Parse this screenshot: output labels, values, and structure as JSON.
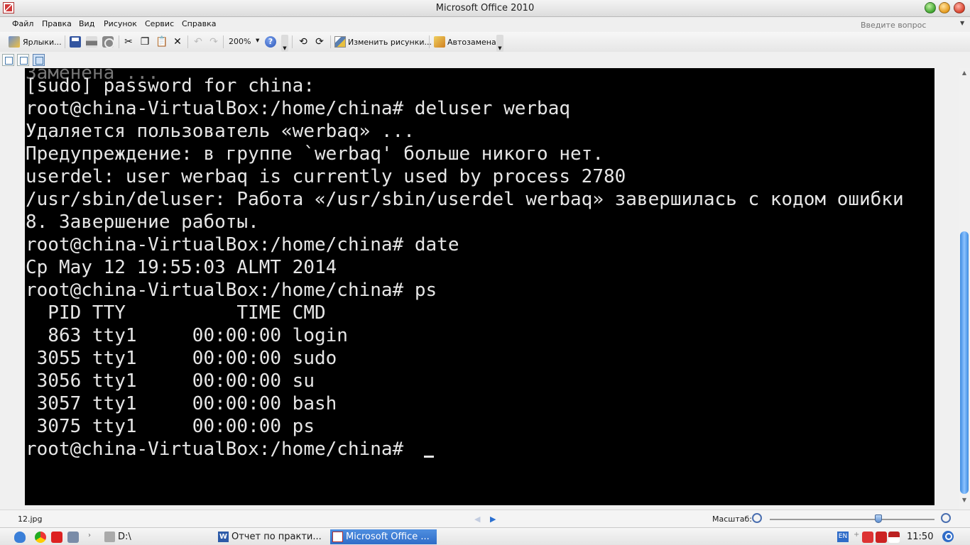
{
  "window": {
    "title": "Microsoft Office 2010"
  },
  "menu": {
    "items": [
      "Файл",
      "Правка",
      "Вид",
      "Рисунок",
      "Сервис",
      "Справка"
    ],
    "help_placeholder": "Введите вопрос"
  },
  "toolbar": {
    "shortcuts_label": "Ярлыки...",
    "zoom_value": "200%",
    "edit_pictures_label": "Изменить рисунки...",
    "autocorrect_label": "Автозамена"
  },
  "terminal": {
    "lines": [
      "[sudo] password for china:",
      "root@china-VirtualBox:/home/china# deluser werbaq",
      "Удаляется пользователь «werbaq» ...",
      "Предупреждение: в группе `werbaq' больше никого нет.",
      "userdel: user werbaq is currently used by process 2780",
      "/usr/sbin/deluser: Работа «/usr/sbin/userdel werbaq» завершилась с кодом ошибки",
      "8. Завершение работы.",
      "root@china-VirtualBox:/home/china# date",
      "Ср Мау 12 19:55:03 ALMT 2014",
      "root@china-VirtualBox:/home/china# ps",
      "  PID TTY          TIME CMD",
      "  863 tty1     00:00:00 login",
      " 3055 tty1     00:00:00 sudo",
      " 3056 tty1     00:00:00 su",
      " 3057 tty1     00:00:00 bash",
      " 3075 tty1     00:00:00 ps",
      "root@china-VirtualBox:/home/china# "
    ]
  },
  "status": {
    "filename": "12.jpg",
    "zoom_label": "Масштаб:",
    "zoom_level": 0.66
  },
  "taskbar": {
    "drive_label": "D:\\",
    "task_report": "Отчет по практи...",
    "task_office": "Microsoft Office ...",
    "lang": "EN",
    "clock": "11:50"
  }
}
